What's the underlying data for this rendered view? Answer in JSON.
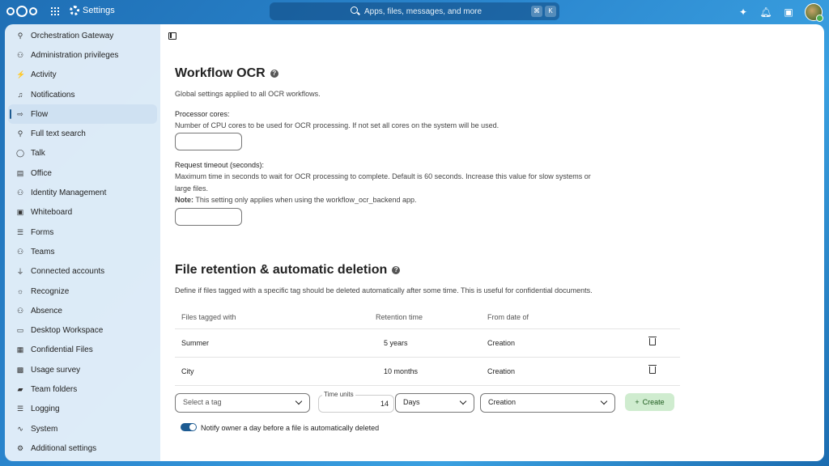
{
  "header": {
    "app_title": "Settings",
    "search_placeholder": "Apps, files, messages, and more",
    "kbd_1": "⌘",
    "kbd_2": "K"
  },
  "sidebar": {
    "items": [
      {
        "label": "Orchestration Gateway",
        "icon": "gateway-icon",
        "glyph": "⚲"
      },
      {
        "label": "Administration privileges",
        "icon": "admin-icon",
        "glyph": "⚇"
      },
      {
        "label": "Activity",
        "icon": "activity-icon",
        "glyph": "⚡"
      },
      {
        "label": "Notifications",
        "icon": "bell-icon",
        "glyph": "♫"
      },
      {
        "label": "Flow",
        "icon": "flow-icon",
        "glyph": "⇨",
        "active": true
      },
      {
        "label": "Full text search",
        "icon": "search-icon",
        "glyph": "⚲"
      },
      {
        "label": "Talk",
        "icon": "talk-icon",
        "glyph": "◯"
      },
      {
        "label": "Office",
        "icon": "office-icon",
        "glyph": "▤"
      },
      {
        "label": "Identity Management",
        "icon": "identity-icon",
        "glyph": "⚇"
      },
      {
        "label": "Whiteboard",
        "icon": "whiteboard-icon",
        "glyph": "▣"
      },
      {
        "label": "Forms",
        "icon": "forms-icon",
        "glyph": "☰"
      },
      {
        "label": "Teams",
        "icon": "teams-icon",
        "glyph": "⚇"
      },
      {
        "label": "Connected accounts",
        "icon": "plug-icon",
        "glyph": "⏚"
      },
      {
        "label": "Recognize",
        "icon": "recognize-icon",
        "glyph": "☼"
      },
      {
        "label": "Absence",
        "icon": "absence-icon",
        "glyph": "⚇"
      },
      {
        "label": "Desktop Workspace",
        "icon": "desktop-icon",
        "glyph": "▭"
      },
      {
        "label": "Confidential Files",
        "icon": "confidential-icon",
        "glyph": "▦"
      },
      {
        "label": "Usage survey",
        "icon": "survey-icon",
        "glyph": "▩"
      },
      {
        "label": "Team folders",
        "icon": "folder-icon",
        "glyph": "▰"
      },
      {
        "label": "Logging",
        "icon": "logging-icon",
        "glyph": "☰"
      },
      {
        "label": "System",
        "icon": "system-icon",
        "glyph": "∿"
      },
      {
        "label": "Additional settings",
        "icon": "gear-icon",
        "glyph": "⚙"
      }
    ]
  },
  "ocr": {
    "title": "Workflow OCR",
    "description": "Global settings applied to all OCR workflows.",
    "cores_label": "Processor cores:",
    "cores_help": "Number of CPU cores to be used for OCR processing. If not set all cores on the system will be used.",
    "timeout_label": "Request timeout (seconds):",
    "timeout_help_1": "Maximum time in seconds to wait for OCR processing to complete. Default is 60 seconds. Increase this value for slow systems or",
    "timeout_help_2": "large files.",
    "note_bold": "Note:",
    "note_text": " This setting only applies when using the workflow_ocr_backend app."
  },
  "retention": {
    "title": "File retention & automatic deletion",
    "description": "Define if files tagged with a specific tag should be deleted automatically after some time. This is useful for confidential documents.",
    "columns": [
      "Files tagged with",
      "Retention time",
      "From date of"
    ],
    "rows": [
      {
        "tag": "Summer",
        "time": "5 years",
        "from": "Creation"
      },
      {
        "tag": "City",
        "time": "10 months",
        "from": "Creation"
      }
    ],
    "tag_select_placeholder": "Select a tag",
    "time_units_label": "Time units",
    "time_units_value": "14",
    "unit_select": "Days",
    "from_select": "Creation",
    "create_label": "Create",
    "notify_label": "Notify owner a day before a file is automatically deleted",
    "notify_enabled": true
  }
}
